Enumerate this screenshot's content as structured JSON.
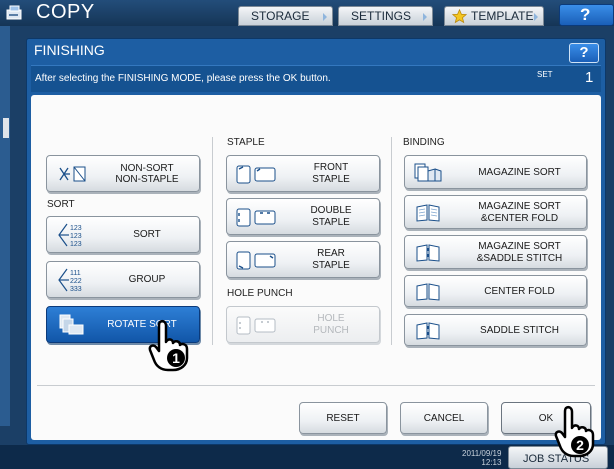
{
  "topbar": {
    "app_title": "COPY",
    "tabs": {
      "storage": "STORAGE",
      "settings": "SETTINGS",
      "template": "TEMPLATE"
    },
    "help": "?"
  },
  "dialog": {
    "title": "FINISHING",
    "help": "?",
    "message": "After selecting the FINISHING MODE, please press the OK button.",
    "set_label": "SET",
    "set_count": "1"
  },
  "sections": {
    "sort": "SORT",
    "staple": "STAPLE",
    "hole_punch": "HOLE PUNCH",
    "binding": "BINDING"
  },
  "buttons": {
    "non_sort": [
      "NON-SORT",
      "NON-STAPLE"
    ],
    "sort": "SORT",
    "group": "GROUP",
    "rotate_sort": "ROTATE SORT",
    "front_staple": [
      "FRONT",
      "STAPLE"
    ],
    "double_staple": [
      "DOUBLE",
      "STAPLE"
    ],
    "rear_staple": [
      "REAR",
      "STAPLE"
    ],
    "hole_punch": [
      "HOLE",
      "PUNCH"
    ],
    "magazine_sort": "MAGAZINE SORT",
    "magazine_center_fold": [
      "MAGAZINE SORT",
      "&CENTER FOLD"
    ],
    "magazine_saddle_stitch": [
      "MAGAZINE SORT",
      "&SADDLE STITCH"
    ],
    "center_fold": "CENTER FOLD",
    "saddle_stitch": "SADDLE STITCH",
    "reset": "RESET",
    "cancel": "CANCEL",
    "ok": "OK"
  },
  "state": {
    "selected": "rotate_sort",
    "hole_punch_enabled": false
  },
  "icons": {
    "sort_digits": [
      "123",
      "123",
      "123"
    ],
    "group_digits": [
      "111",
      "222",
      "333"
    ]
  },
  "callouts": {
    "step1": "1",
    "step2": "2"
  },
  "statusbar": {
    "date": "2011/09/19",
    "time": "12:13",
    "job_status": "JOB STATUS"
  },
  "colors": {
    "selected": "#1a6cc4",
    "dialog": "#1d5ea3",
    "topbar": "#1b3f66"
  }
}
